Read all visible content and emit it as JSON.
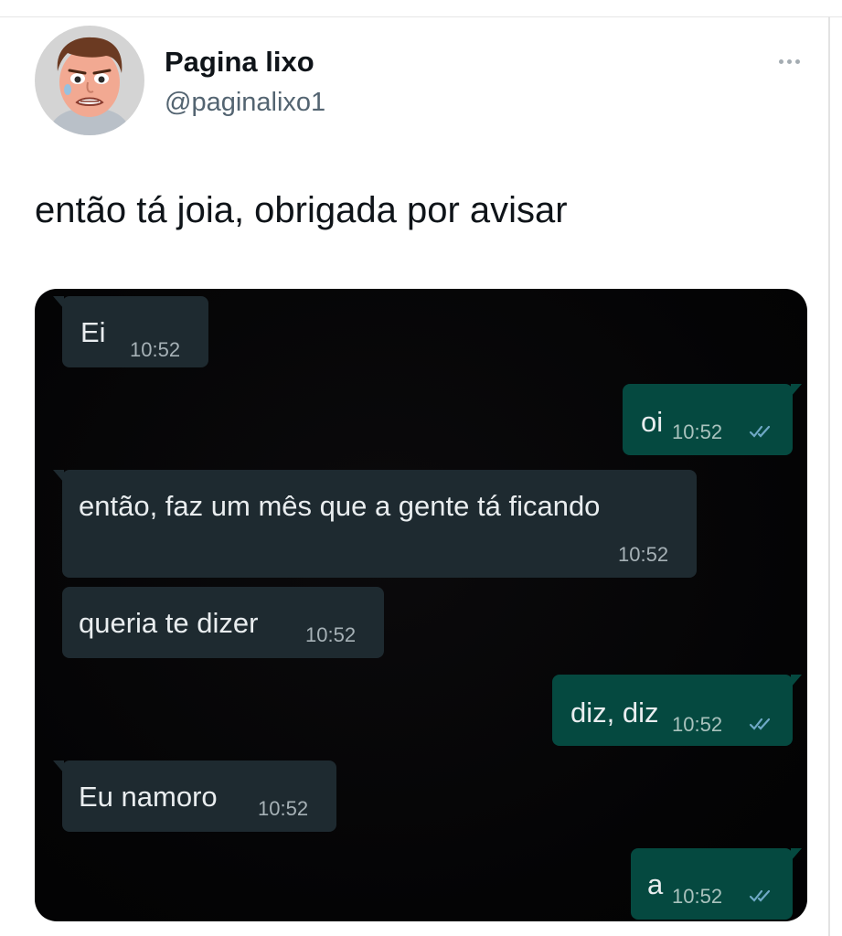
{
  "author": {
    "name": "Pagina lixo",
    "handle": "@paginalixo1"
  },
  "more_icon": "more-horizontal-icon",
  "tweet_text": "então tá joia, obrigada por avisar",
  "chat": {
    "messages": [
      {
        "direction": "incoming",
        "text": "Ei",
        "time": "10:52"
      },
      {
        "direction": "outgoing",
        "text": "oi",
        "time": "10:52",
        "status_icon": "double-check-icon"
      },
      {
        "direction": "incoming",
        "text": "então, faz um mês que a gente tá ficando",
        "time": "10:52"
      },
      {
        "direction": "incoming",
        "text": "queria te dizer",
        "time": "10:52"
      },
      {
        "direction": "outgoing",
        "text": "diz, diz",
        "time": "10:52",
        "status_icon": "double-check-icon"
      },
      {
        "direction": "incoming",
        "text": "Eu namoro",
        "time": "10:52"
      },
      {
        "direction": "outgoing",
        "text": "a",
        "time": "10:52",
        "status_icon": "double-check-icon"
      }
    ]
  },
  "colors": {
    "incoming_bubble": "#1e2a30",
    "outgoing_bubble": "#054940",
    "chat_background": "#040405",
    "handle_text": "#536471"
  }
}
